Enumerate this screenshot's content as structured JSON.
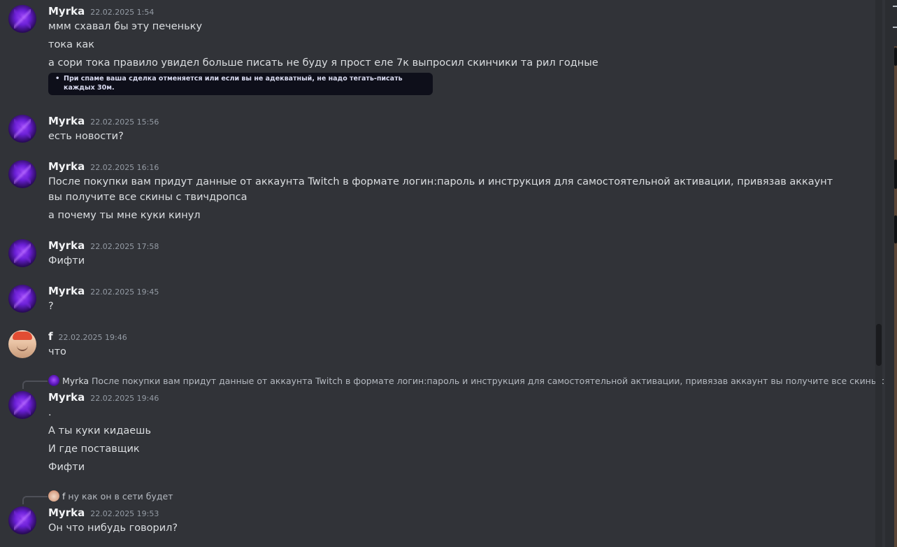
{
  "messages": [
    {
      "author": "Myrka",
      "timestamp": "22.02.2025 1:54",
      "lines": [
        "ммм схавал бы эту печеньку",
        "тока как",
        "а сори тока правило увидел больше писать не буду я прост еле 7к выпросил скинчики та рил годные"
      ],
      "image_text": "При спаме ваша сделка отменяется или если вы не адекватный, не надо тегать-писать каждых 30м."
    },
    {
      "author": "Myrka",
      "timestamp": "22.02.2025 15:56",
      "lines": [
        "есть новости?"
      ]
    },
    {
      "author": "Myrka",
      "timestamp": "22.02.2025 16:16",
      "lines": [
        "После покупки вам придут данные от аккаунта Twitch в формате логин:пароль и инструкция для самостоятельной активации, привязав аккаунт вы получите все скины с твичдропса",
        "а почему ты мне куки кинул"
      ]
    },
    {
      "author": "Myrka",
      "timestamp": "22.02.2025 17:58",
      "lines": [
        "Фифти"
      ]
    },
    {
      "author": "Myrka",
      "timestamp": "22.02.2025 19:45",
      "lines": [
        "?"
      ]
    },
    {
      "author": "f",
      "timestamp": "22.02.2025 19:46",
      "lines": [
        "что"
      ]
    },
    {
      "reply": {
        "author": "Myrka",
        "text": "После покупки вам придут данные от аккаунта Twitch в формате логин:пароль и инструкция для самостоятельной активации, привязав аккаунт вы получите все скины с твич..."
      },
      "author": "Myrka",
      "timestamp": "22.02.2025 19:46",
      "lines": [
        ".",
        "А ты куки кидаешь",
        "И где поставщик",
        "Фифти"
      ]
    },
    {
      "reply": {
        "author": "f",
        "text": "ну как он в сети будет"
      },
      "author": "Myrka",
      "timestamp": "22.02.2025 19:53",
      "lines": [
        "Он что нибудь говорил?"
      ]
    }
  ]
}
